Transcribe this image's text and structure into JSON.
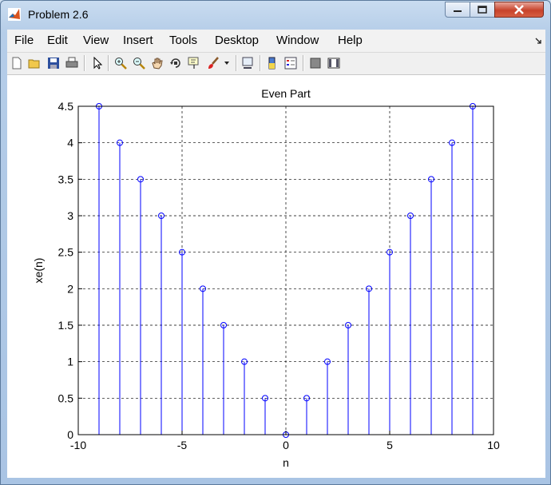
{
  "window": {
    "title": "Problem 2.6"
  },
  "menu": [
    "File",
    "Edit",
    "View",
    "Insert",
    "Tools",
    "Desktop",
    "Window",
    "Help"
  ],
  "toolbar_icons": [
    "new-figure-icon",
    "open-file-icon",
    "save-icon",
    "print-icon",
    "pointer-icon",
    "zoom-in-icon",
    "zoom-out-icon",
    "pan-icon",
    "rotate-3d-icon",
    "data-cursor-icon",
    "brush-icon",
    "dropdown-arrow-icon",
    "link-plot-icon",
    "colorbar-icon",
    "legend-icon",
    "hide-plot-tools-icon",
    "show-plot-tools-icon"
  ],
  "chart_data": {
    "type": "stem",
    "title": "Even Part",
    "xlabel": "n",
    "ylabel": "xe(n)",
    "xlim": [
      -10,
      10
    ],
    "ylim": [
      0,
      4.5
    ],
    "x_ticks": [
      "-10",
      "-5",
      "0",
      "5",
      "10"
    ],
    "y_ticks": [
      "0",
      "0.5",
      "1",
      "1.5",
      "2",
      "2.5",
      "3",
      "3.5",
      "4",
      "4.5"
    ],
    "grid": true,
    "color": "#0000ff",
    "x": [
      -9,
      -8,
      -7,
      -6,
      -5,
      -4,
      -3,
      -2,
      -1,
      0,
      1,
      2,
      3,
      4,
      5,
      6,
      7,
      8,
      9
    ],
    "values": [
      4.5,
      4,
      3.5,
      3,
      2.5,
      2,
      1.5,
      1,
      0.5,
      0,
      0.5,
      1,
      1.5,
      2,
      2.5,
      3,
      3.5,
      4,
      4.5
    ]
  }
}
